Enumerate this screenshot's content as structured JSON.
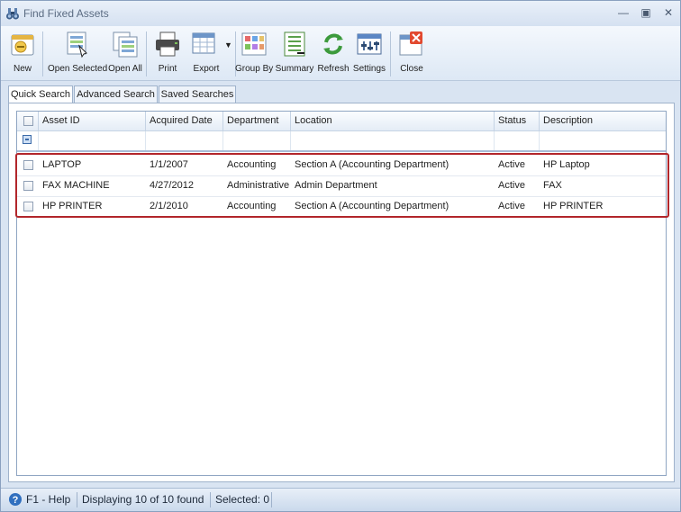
{
  "window": {
    "title": "Find Fixed Assets"
  },
  "toolbar": {
    "new_label": "New",
    "open_selected_label": "Open Selected",
    "open_all_label": "Open All",
    "print_label": "Print",
    "export_label": "Export",
    "group_by_label": "Group By",
    "summary_label": "Summary",
    "refresh_label": "Refresh",
    "settings_label": "Settings",
    "close_label": "Close"
  },
  "tabs": [
    {
      "label": "Quick Search",
      "active": true
    },
    {
      "label": "Advanced Search",
      "active": false
    },
    {
      "label": "Saved Searches",
      "active": false
    }
  ],
  "grid": {
    "columns": [
      "Asset ID",
      "Acquired Date",
      "Department",
      "Location",
      "Status",
      "Description"
    ],
    "rows": [
      {
        "asset_id": "LAPTOP",
        "acquired_date": "1/1/2007",
        "department": "Accounting",
        "location": "Section A (Accounting Department)",
        "status": "Active",
        "description": "HP Laptop"
      },
      {
        "asset_id": "FAX MACHINE",
        "acquired_date": "4/27/2012",
        "department": "Administrative",
        "location": "Admin Department",
        "status": "Active",
        "description": "FAX"
      },
      {
        "asset_id": "HP PRINTER",
        "acquired_date": "2/1/2010",
        "department": "Accounting",
        "location": "Section A (Accounting Department)",
        "status": "Active",
        "description": "HP PRINTER"
      }
    ]
  },
  "statusbar": {
    "help": "F1 - Help",
    "display": "Displaying 10 of 10 found",
    "selected": "Selected: 0"
  },
  "colors": {
    "highlight": "#b2262b",
    "chrome": "#d9e4f2"
  }
}
